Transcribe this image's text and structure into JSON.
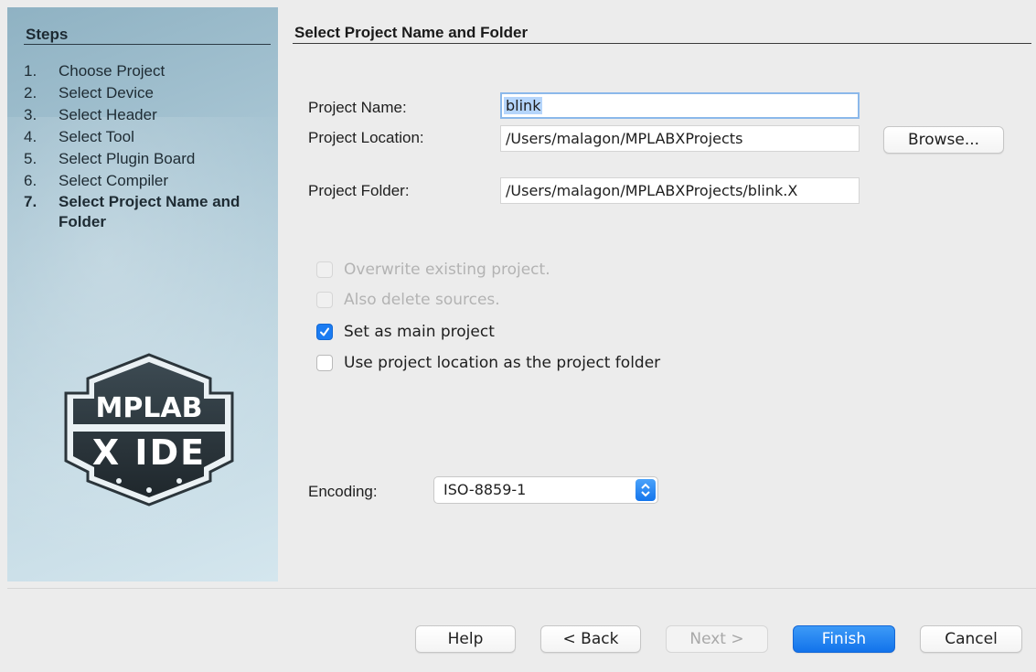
{
  "steps": {
    "title": "Steps",
    "items": [
      {
        "num": "1.",
        "label": "Choose Project"
      },
      {
        "num": "2.",
        "label": "Select Device"
      },
      {
        "num": "3.",
        "label": "Select Header"
      },
      {
        "num": "4.",
        "label": "Select Tool"
      },
      {
        "num": "5.",
        "label": "Select Plugin Board"
      },
      {
        "num": "6.",
        "label": "Select Compiler"
      },
      {
        "num": "7.",
        "label": "Select Project Name and Folder"
      }
    ],
    "current_index": 7,
    "logo": {
      "line1": "MPLAB",
      "line2": "X IDE"
    }
  },
  "content": {
    "title": "Select Project Name and Folder",
    "project_name": {
      "label": "Project Name:",
      "value": "blink"
    },
    "project_location": {
      "label": "Project Location:",
      "value": "/Users/malagon/MPLABXProjects"
    },
    "browse_label": "Browse...",
    "project_folder": {
      "label": "Project Folder:",
      "value": "/Users/malagon/MPLABXProjects/blink.X"
    },
    "options": [
      {
        "label": "Overwrite existing project.",
        "checked": false,
        "enabled": false
      },
      {
        "label": "Also delete sources.",
        "checked": false,
        "enabled": false
      },
      {
        "label": "Set as main project",
        "checked": true,
        "enabled": true
      },
      {
        "label": "Use project location as the project folder",
        "checked": false,
        "enabled": true
      }
    ],
    "encoding": {
      "label": "Encoding:",
      "value": "ISO-8859-1"
    }
  },
  "footer": {
    "help": "Help",
    "back": "< Back",
    "next": "Next >",
    "finish": "Finish",
    "cancel": "Cancel"
  },
  "colors": {
    "accent": "#1b7cf2",
    "selection": "#b5d5fb",
    "panel": "#a9c6d4"
  }
}
